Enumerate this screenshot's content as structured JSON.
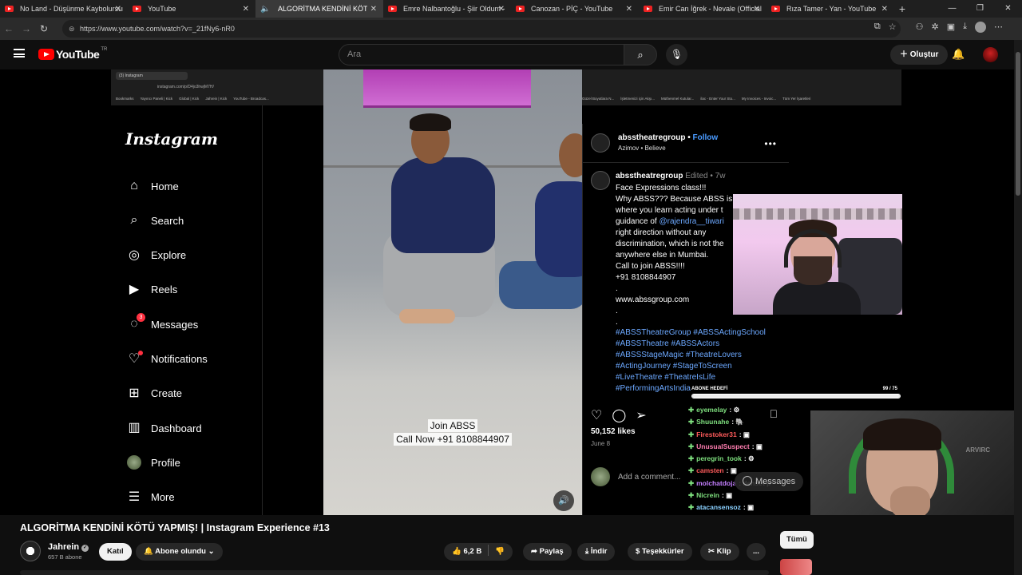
{
  "browser": {
    "tabs": [
      {
        "title": "No Land - Düşünme Kaybolursun",
        "active": false
      },
      {
        "title": "YouTube",
        "active": false
      },
      {
        "title": "ALGORİTMA KENDİNİ KÖTÜ",
        "active": true
      },
      {
        "title": "Emre Nalbantoğlu - Şiir Oldum -",
        "active": false
      },
      {
        "title": "Canozan - PİÇ - YouTube",
        "active": false
      },
      {
        "title": "Emir Can İğrek - Nevale (Official V",
        "active": false
      },
      {
        "title": "Rıza Tamer - Yan - YouTube",
        "active": false
      }
    ],
    "url": "https://www.youtube.com/watch?v=_21fNy6-nR0"
  },
  "youtube": {
    "logo_text": "YouTube",
    "region": "TR",
    "search_placeholder": "Ara",
    "create_label": "Oluştur"
  },
  "video_content": {
    "inner_browser": {
      "tab_title": "(3) Instagram",
      "url": "instagram.com/p/D4jo3hwjM7H/",
      "bookmarks": [
        "Bookmarks",
        "Yayıncı Paneli | Kick",
        "Global | Kick",
        "Jahrein | Kick",
        "YouTube - Broadcas..."
      ],
      "bookmarks_right": [
        "Güzel Boyutlara N...",
        "İşletmenizi için Akşı...",
        "Müthenmel Kutular...",
        "ilac - Enter Your Sto...",
        "My Invoices - Invoic...",
        "Tüm Yer İşaretleri"
      ]
    },
    "instagram_nav": {
      "logo": "Instagram",
      "items": [
        {
          "label": "Home",
          "icon": "home-icon"
        },
        {
          "label": "Search",
          "icon": "search-icon"
        },
        {
          "label": "Explore",
          "icon": "compass-icon"
        },
        {
          "label": "Reels",
          "icon": "reels-icon"
        },
        {
          "label": "Messages",
          "icon": "messenger-icon",
          "badge": "3"
        },
        {
          "label": "Notifications",
          "icon": "heart-icon"
        },
        {
          "label": "Create",
          "icon": "plus-square-icon"
        },
        {
          "label": "Dashboard",
          "icon": "dashboard-icon"
        },
        {
          "label": "Profile",
          "icon": "profile-icon"
        },
        {
          "label": "More",
          "icon": "menu-icon"
        }
      ]
    },
    "reel_caption": {
      "line1": "Join ABSS",
      "line2": "Call Now +91 8108844907"
    },
    "post": {
      "username": "absstheatregroup",
      "follow": "Follow",
      "audio": "Azimov • Believe",
      "caption_user": "absstheatregroup",
      "edited": "Edited",
      "age": "7w",
      "caption_text": "Face Expressions class!!!\nWhy ABSS??? Because ABSS is a\nwhere you learn acting under t\nguidance of",
      "mention": "@rajendra__tiwari",
      "caption_text2": "right direction without any\ndiscrimination, which is not the\nanywhere else in Mumbai.\nCall to join ABSS!!!!\n+91 8108844907\n.\nwww.abssgroup.com\n.\n.",
      "hashtags": "#ABSSTheatreGroup #ABSSActingSchool #ABSSTheatre #ABSSActors #ABSSStageMagic #TheatreLovers #ActingJourney #StageToScreen #LiveTheatre #TheatreIsLife #PerformingArtsIndia",
      "likes": "50,152 likes",
      "date": "June 8",
      "comment_placeholder": "Add a comment..."
    },
    "stream_overlay": {
      "goal_label": "ABONE HEDEFİ",
      "goal_count": "99 / 75",
      "goal_fraction": 1.0,
      "chat": [
        {
          "user": "eyemelay",
          "color": "#7fe07f",
          "msg": ": ⚙"
        },
        {
          "user": "Shuunahe",
          "color": "#7fe07f",
          "msg": ": 🐘"
        },
        {
          "user": "Firestoker31",
          "color": "#ff5b5b",
          "msg": ": ▣"
        },
        {
          "user": "UnusualSuspect",
          "color": "#ff7db0",
          "msg": ": ▣"
        },
        {
          "user": "peregrin_took",
          "color": "#7fe07f",
          "msg": ": ⚙"
        },
        {
          "user": "camsten",
          "color": "#ff5b5b",
          "msg": ": ▣"
        },
        {
          "user": "molchatdoja",
          "color": "#c47fff",
          "msg": ": dehset p"
        },
        {
          "user": "Nicrein",
          "color": "#7fe07f",
          "msg": ": ▣"
        },
        {
          "user": "atacansensoz",
          "color": "#8ad0ff",
          "msg": ": ▣"
        }
      ],
      "messages_popup": "Messages",
      "cam_logo": "ARVIRC"
    }
  },
  "watch": {
    "title": "ALGORİTMA KENDİNİ KÖTÜ YAPMIŞ! | Instagram Experience #13",
    "channel": "Jahrein",
    "subscribers": "657 B abone",
    "join": "Katıl",
    "subscribed": "Abone olundu",
    "likes": "6,2 B",
    "share": "Paylaş",
    "download": "İndir",
    "thanks": "Teşekkürler",
    "clip": "Klip",
    "more": "...",
    "filter_all": "Tümü"
  }
}
